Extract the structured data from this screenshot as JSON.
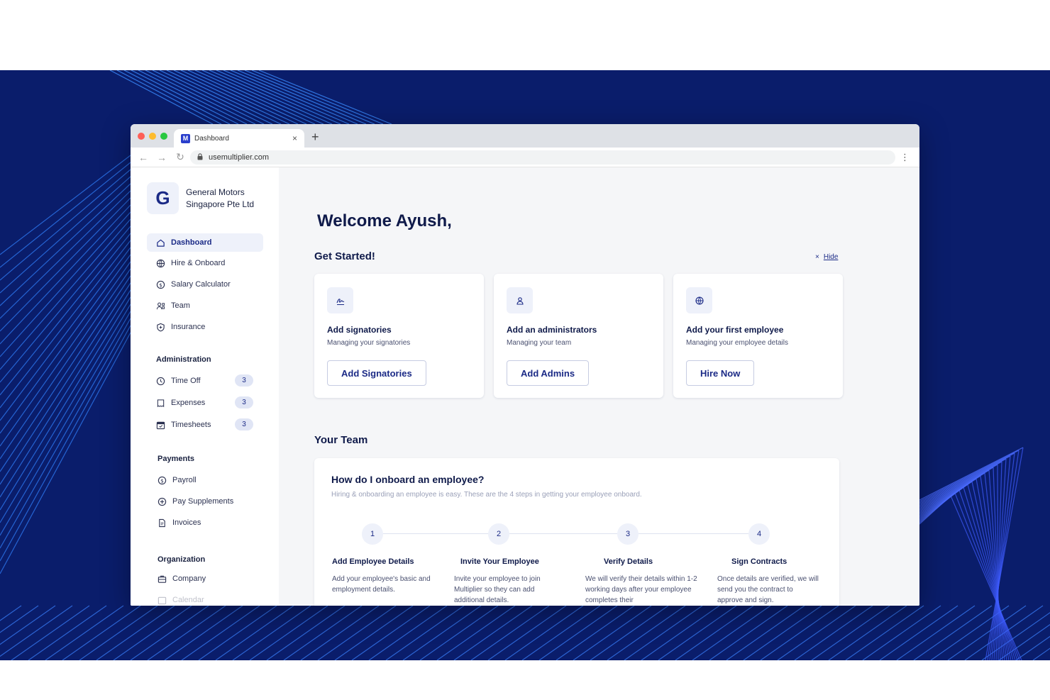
{
  "browser": {
    "tab_title": "Dashboard",
    "favicon_letter": "M",
    "tab_close": "×",
    "new_tab": "+",
    "url": "usemultiplier.com"
  },
  "sidebar": {
    "avatar_letter": "G",
    "company_name": "General Motors Singapore Pte Ltd",
    "main_items": [
      {
        "label": "Dashboard",
        "icon": "home-icon"
      },
      {
        "label": "Hire & Onboard",
        "icon": "globe-icon"
      },
      {
        "label": "Salary Calculator",
        "icon": "dollar-icon"
      },
      {
        "label": "Team",
        "icon": "team-icon"
      },
      {
        "label": "Insurance",
        "icon": "shield-icon"
      }
    ],
    "administration_title": "Administration",
    "administration_items": [
      {
        "label": "Time Off",
        "badge": "3",
        "icon": "clock-icon"
      },
      {
        "label": "Expenses",
        "badge": "3",
        "icon": "receipt-icon"
      },
      {
        "label": "Timesheets",
        "badge": "3",
        "icon": "calendar-icon"
      }
    ],
    "payments_title": "Payments",
    "payments_items": [
      {
        "label": "Payroll",
        "icon": "payroll-icon"
      },
      {
        "label": "Pay Supplements",
        "icon": "plus-circle-icon"
      },
      {
        "label": "Invoices",
        "icon": "invoice-icon"
      }
    ],
    "organization_title": "Organization",
    "organization_items": [
      {
        "label": "Company",
        "icon": "briefcase-icon"
      },
      {
        "label": "Calendar",
        "icon": "calendar-icon"
      }
    ]
  },
  "main": {
    "welcome": "Welcome Ayush,",
    "get_started": "Get Started!",
    "hide_icon": "×",
    "hide_label": "Hide",
    "cards": [
      {
        "title": "Add signatories",
        "subtitle": "Managing your signatories",
        "button": "Add Signatories",
        "icon": "signature-icon"
      },
      {
        "title": "Add an administrators",
        "subtitle": "Managing your team",
        "button": "Add Admins",
        "icon": "admin-icon"
      },
      {
        "title": "Add your first employee",
        "subtitle": "Managing your employee details",
        "button": "Hire Now",
        "icon": "globe-icon"
      }
    ],
    "your_team": "Your Team",
    "onboard_title": "How do I onboard an employee?",
    "onboard_subtitle": "Hiring & onboarding an employee is easy. These are the 4 steps in getting your employee onboard.",
    "steps": [
      {
        "num": "1",
        "title": "Add Employee Details",
        "desc": "Add your employee's basic and employment details."
      },
      {
        "num": "2",
        "title": "Invite Your Employee",
        "desc": "Invite your employee to join Multiplier so they can add additional details."
      },
      {
        "num": "3",
        "title": "Verify Details",
        "desc": "We will verify their details within 1-2 working days after your employee completes their"
      },
      {
        "num": "4",
        "title": "Sign Contracts",
        "desc": "Once details are verified, we will send you the contract to approve and sign."
      }
    ]
  },
  "colors": {
    "brand": "#1b2a86",
    "background": "#0a1d6b",
    "accent_light": "#eef1fa"
  }
}
